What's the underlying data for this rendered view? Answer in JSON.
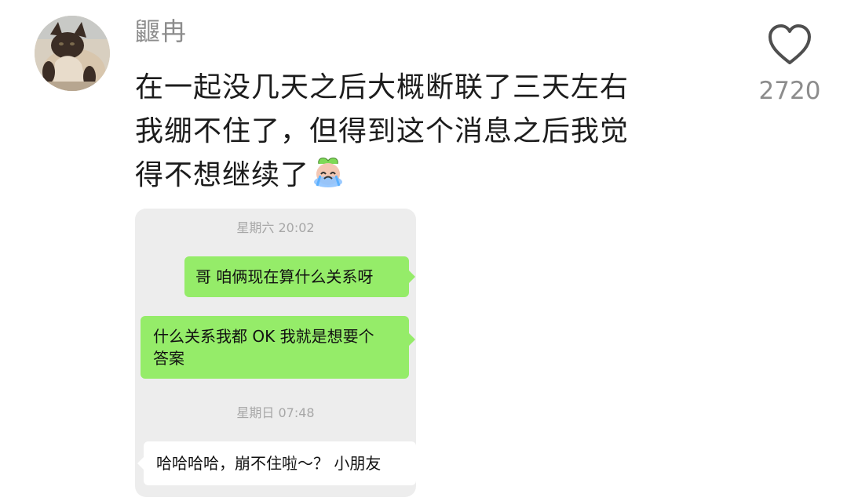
{
  "comment": {
    "username": "鼴冉",
    "lines": [
      "在一起没几天之后大概断联了三天左右",
      "我绷不住了，但得到这个消息之后我觉",
      "得不想继续了"
    ],
    "emoji": "crying-face-emoji"
  },
  "like": {
    "icon": "heart-outline-icon",
    "count": "2720"
  },
  "chat_screenshot": {
    "timestamps": [
      "星期六 20:02",
      "星期日 07:48"
    ],
    "messages": [
      {
        "side": "right",
        "text": "哥 咱俩现在算什么关系呀"
      },
      {
        "side": "right",
        "lines": [
          "什么关系我都 OK 我就是想要个",
          "答案"
        ]
      },
      {
        "side": "left",
        "text": "哈哈哈哈，崩不住啦～？ 小朋友"
      }
    ],
    "colors": {
      "background": "#ededed",
      "sent_bubble": "#95ec69",
      "received_bubble": "#ffffff"
    }
  }
}
